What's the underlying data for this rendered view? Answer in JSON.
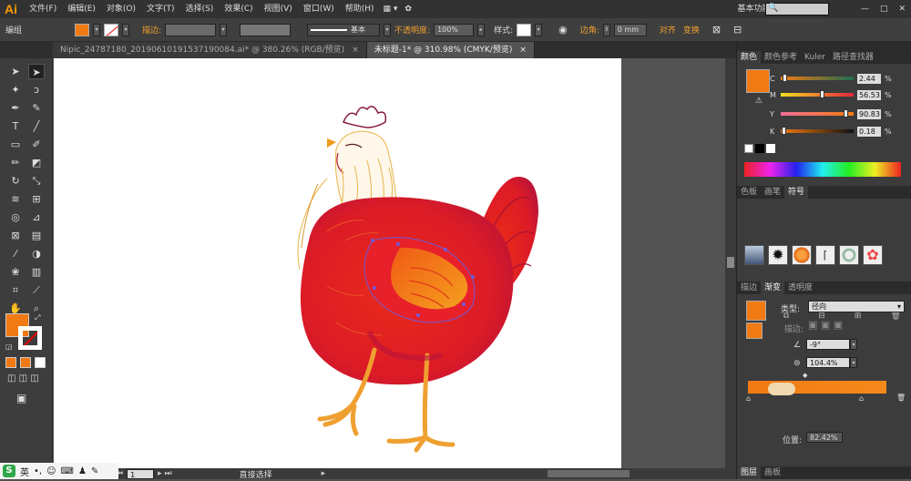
{
  "app": {
    "logo": "Ai",
    "workspace": "基本功能"
  },
  "menu": [
    "文件(F)",
    "编辑(E)",
    "对象(O)",
    "文字(T)",
    "选择(S)",
    "效果(C)",
    "视图(V)",
    "窗口(W)",
    "帮助(H)"
  ],
  "control": {
    "mode": "编组",
    "fill_color": "#f27a12",
    "stroke_label": "描边:",
    "stroke_preset": "基本",
    "opacity_label": "不透明度:",
    "opacity_value": "100%",
    "style_label": "样式:",
    "corner_label": "边角:",
    "corner_value": "0 mm",
    "align_label": "对齐",
    "transform_label": "变换"
  },
  "tabs": [
    {
      "title": "Nipic_24787180_20190610191537190084.ai* @ 380.26% (RGB/预览)",
      "close": "×",
      "active": false
    },
    {
      "title": "未标题-1* @ 310.98% (CMYK/预览)",
      "close": "×",
      "active": true
    }
  ],
  "color_panel": {
    "tabs": [
      "颜色",
      "颜色参考",
      "Kuler",
      "路径查找器"
    ],
    "swatch": "#f27a12",
    "channels": [
      {
        "name": "C",
        "value": "2.44",
        "pos": 0.03
      },
      {
        "name": "M",
        "value": "56.53",
        "pos": 0.57
      },
      {
        "name": "Y",
        "value": "90.83",
        "pos": 0.91
      },
      {
        "name": "K",
        "value": "0.18",
        "pos": 0.01
      }
    ],
    "unit": "%"
  },
  "swatch_panel": {
    "tabs": [
      "色板",
      "画笔",
      "符号"
    ],
    "active": "符号"
  },
  "gradient_panel": {
    "tabs": [
      "描边",
      "渐变",
      "透明度"
    ],
    "type_label": "类型:",
    "type_value": "径向",
    "stroke_label": "描边:",
    "angle_value": "-9°",
    "ratio_value": "104.4%",
    "position_label": "位置:",
    "position_value": "82.42%"
  },
  "bottom_panel": {
    "tabs": [
      "图层",
      "画板"
    ]
  },
  "status": {
    "zoom_field": "1",
    "tool_name": "直接选择"
  },
  "ime": {
    "logo": "S",
    "lang": "英"
  }
}
